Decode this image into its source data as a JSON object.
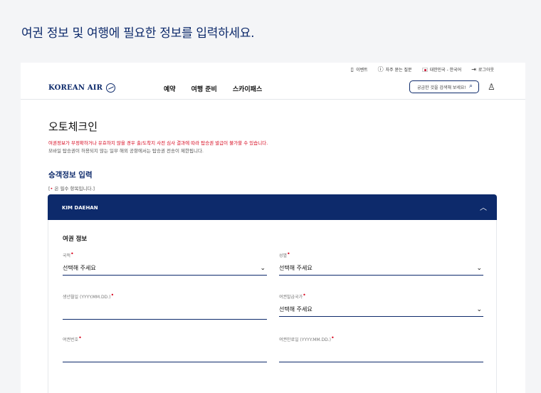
{
  "instruction": "여권 정보 및 여행에 필요한 정보를 입력하세요.",
  "util_bar": {
    "events": "이벤트",
    "faq": "자주 묻는 질문",
    "region": "대한민국 - 한국어",
    "login": "로그아웃"
  },
  "nav": {
    "logo": "KOREAN AIR",
    "menu": [
      "예약",
      "여행 준비",
      "스카이패스"
    ],
    "search_placeholder": "궁금한 것을 검색해 보세요!"
  },
  "page": {
    "title": "오토체크인",
    "notice_red": "여권정보가 부정확하거나 유효하지 않을 경우 출/도착지 사전 심사 결과에 따라 탑승권 발급이 불가할 수 있습니다.",
    "notice_grey": "모바일 탑승권이 허용되지 않는 일부 해외 공항에서는 탑승권 전송이 제한됩니다.",
    "section_title": "승객정보 입력",
    "required_prefix": "[",
    "required_star": "•",
    "required_text": " 은 필수 항목입니다.]"
  },
  "passenger": {
    "name": "KIM DAEHAN"
  },
  "passport_form": {
    "title": "여권 정보",
    "nationality": {
      "label": "국적",
      "value": "선택해 주세요"
    },
    "gender": {
      "label": "성별",
      "value": "선택해 주세요"
    },
    "birthdate": {
      "label": "생년월일 (YYYY.MM.DD.)",
      "value": ""
    },
    "issuing_country": {
      "label": "여권발급국가",
      "value": "선택해 주세요"
    },
    "passport_number": {
      "label": "여권번호",
      "value": ""
    },
    "expiry_date": {
      "label": "여권만료일 (YYYY.MM.DD.)",
      "value": ""
    }
  },
  "colors": {
    "brand": "#0d2a6b",
    "required": "#d7081f"
  }
}
